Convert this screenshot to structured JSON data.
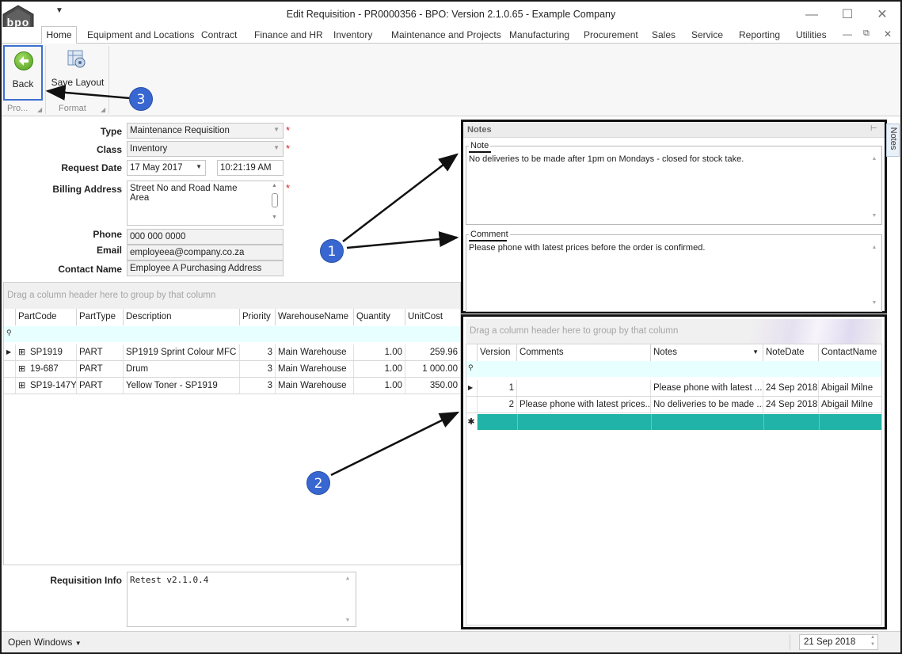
{
  "window": {
    "title": "Edit Requisition - PR0000356 - BPO: Version 2.1.0.65 - Example Company",
    "logo_text": "bpo"
  },
  "menu": {
    "tabs": [
      "Home",
      "Equipment and Locations",
      "Contract",
      "Finance and HR",
      "Inventory",
      "Maintenance and Projects",
      "Manufacturing",
      "Procurement",
      "Sales",
      "Service",
      "Reporting",
      "Utilities"
    ]
  },
  "ribbon": {
    "back_label": "Back",
    "save_layout_label": "Save Layout",
    "group_process": "Pro...",
    "group_format": "Format"
  },
  "form": {
    "type_label": "Type",
    "type_value": "Maintenance Requisition",
    "class_label": "Class",
    "class_value": "Inventory",
    "request_date_label": "Request Date",
    "request_date_value": "17 May 2017",
    "request_time_value": "10:21:19 AM",
    "billing_label": "Billing Address",
    "billing_line1": "Street No and Road Name",
    "billing_line2": "Area",
    "phone_label": "Phone",
    "phone_value": "000 000 0000",
    "email_label": "Email",
    "email_value": "employeea@company.co.za",
    "contact_label": "Contact Name",
    "contact_value": "Employee A Purchasing Address",
    "required_mark": "*"
  },
  "items_grid": {
    "group_hint": "Drag a column header here to group by that column",
    "columns": [
      "PartCode",
      "PartType",
      "Description",
      "Priority",
      "WarehouseName",
      "Quantity",
      "UnitCost"
    ],
    "rows": [
      [
        "SP1919",
        "PART",
        "SP1919 Sprint Colour MFC",
        "3",
        "Main Warehouse",
        "1.00",
        "259.96"
      ],
      [
        "19-687",
        "PART",
        "Drum",
        "3",
        "Main Warehouse",
        "1.00",
        "1 000.00"
      ],
      [
        "SP19-147Y",
        "PART",
        "Yellow Toner - SP1919",
        "3",
        "Main Warehouse",
        "1.00",
        "350.00"
      ]
    ]
  },
  "requisition_info": {
    "label": "Requisition Info",
    "value": "Retest v2.1.0.4"
  },
  "notes_panel": {
    "title": "Notes",
    "note_legend": "Note",
    "note_text": "No deliveries to be made after 1pm on Mondays - closed for stock take.",
    "comment_legend": "Comment",
    "comment_text": "Please phone with latest prices before the order is confirmed.",
    "side_tab": "Notes"
  },
  "notes_grid": {
    "group_hint": "Drag a column header here to group by that column",
    "columns": [
      "Version",
      "Comments",
      "Notes",
      "NoteDate",
      "ContactName"
    ],
    "rows": [
      [
        "1",
        "",
        "Please phone with latest ...",
        "24 Sep 2018",
        "Abigail Milne"
      ],
      [
        "2",
        "Please phone with latest prices...",
        "No deliveries to be made ...",
        "24 Sep 2018",
        "Abigail Milne"
      ]
    ]
  },
  "callouts": [
    "1",
    "2",
    "3"
  ],
  "statusbar": {
    "open_windows": "Open Windows",
    "date": "21 Sep 2018"
  },
  "colors": {
    "accent_blue": "#3967d1",
    "new_row_teal": "#22b3a8",
    "filter_row": "#e8ffff",
    "required_red": "#d52020"
  }
}
